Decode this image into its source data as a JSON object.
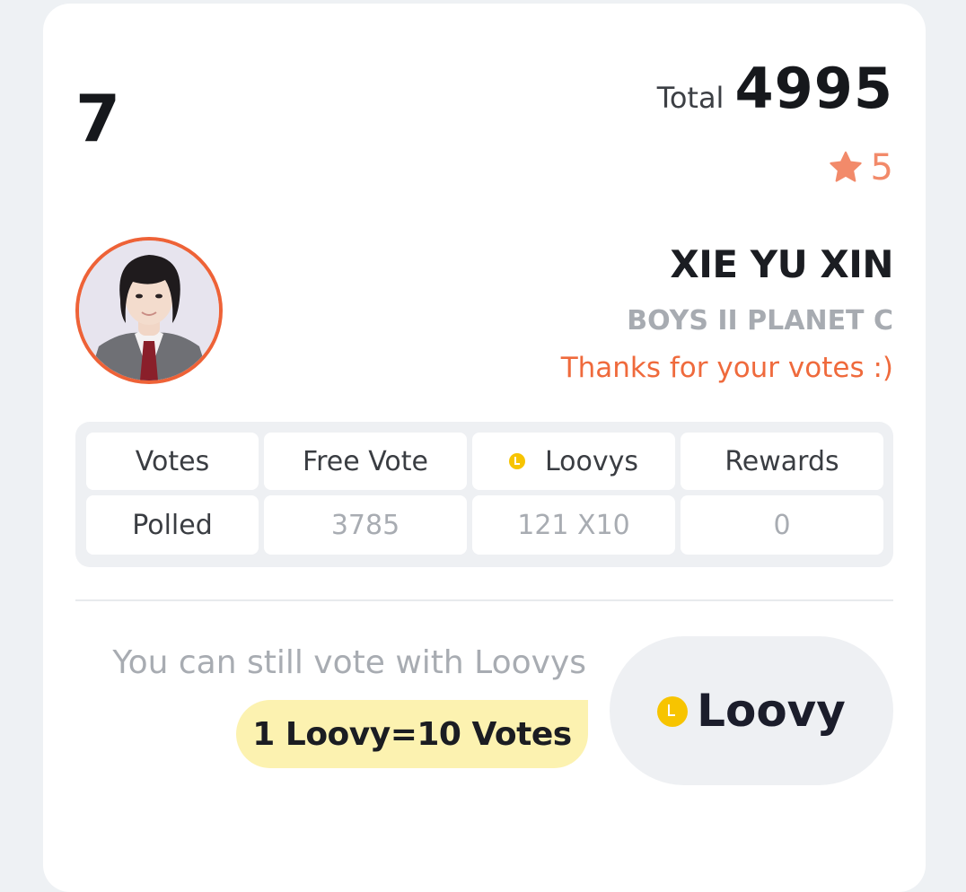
{
  "rank": "7",
  "total": {
    "label": "Total",
    "value": "4995"
  },
  "stars": {
    "icon": "star-icon",
    "count": "5",
    "color": "#f28a6a"
  },
  "candidate": {
    "name": "XIE YU XIN",
    "group": "BOYS II PLANET C",
    "message": "Thanks for your votes :)",
    "avatar_border_color": "#ee6237"
  },
  "stats": {
    "headers": [
      "Votes",
      "Free Vote",
      "Loovys",
      "Rewards"
    ],
    "row_label": "Polled",
    "values": [
      "3785",
      "121 X10",
      "0"
    ],
    "loovy_icon": "loovy-coin-icon"
  },
  "footer": {
    "hint": "You can still vote with Loovys",
    "rate": "1 Loovy=10 Votes",
    "button_label": "Loovy",
    "button_icon": "loovy-coin-icon",
    "coin_color": "#f7c400",
    "rate_bg": "#fcf2b0"
  }
}
